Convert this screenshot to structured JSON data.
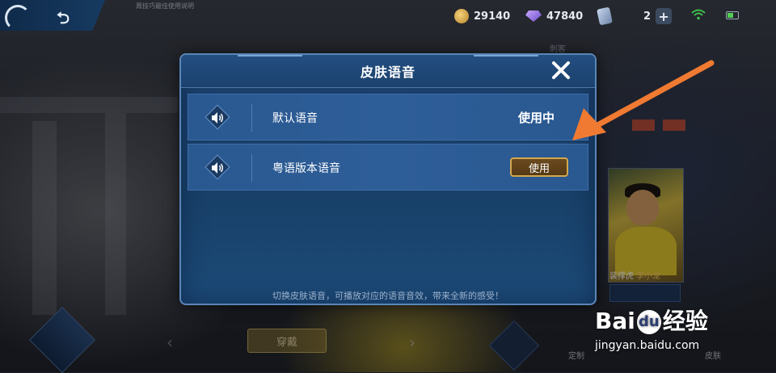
{
  "topbar": {
    "hint": "周技巧最佳使用说明",
    "gold": "29140",
    "gems": "47840",
    "cards": "2"
  },
  "background": {
    "hero_header": "刺客",
    "hero_skin_name": "装撑虎",
    "hero_name": "李小龙",
    "wear_button": "穿戴",
    "customize_label": "定制",
    "skin_label": "皮肤"
  },
  "modal": {
    "title": "皮肤语音",
    "voices": [
      {
        "name": "默认语音",
        "status": "使用中"
      },
      {
        "name": "粤语版本语音",
        "button": "使用"
      }
    ],
    "footer": "切换皮肤语音，可播放对应的语音音效，带来全新的感受！"
  },
  "watermark": {
    "brand_left": "Bai",
    "brand_mid": "du",
    "brand_right": "经验",
    "url": "jingyan.baidu.com"
  },
  "colors": {
    "modal_bg": "#1b3f6c",
    "row_bg": "#2e5e98",
    "use_button_border": "#d2a84e",
    "annotation_arrow": "#f07a32"
  }
}
